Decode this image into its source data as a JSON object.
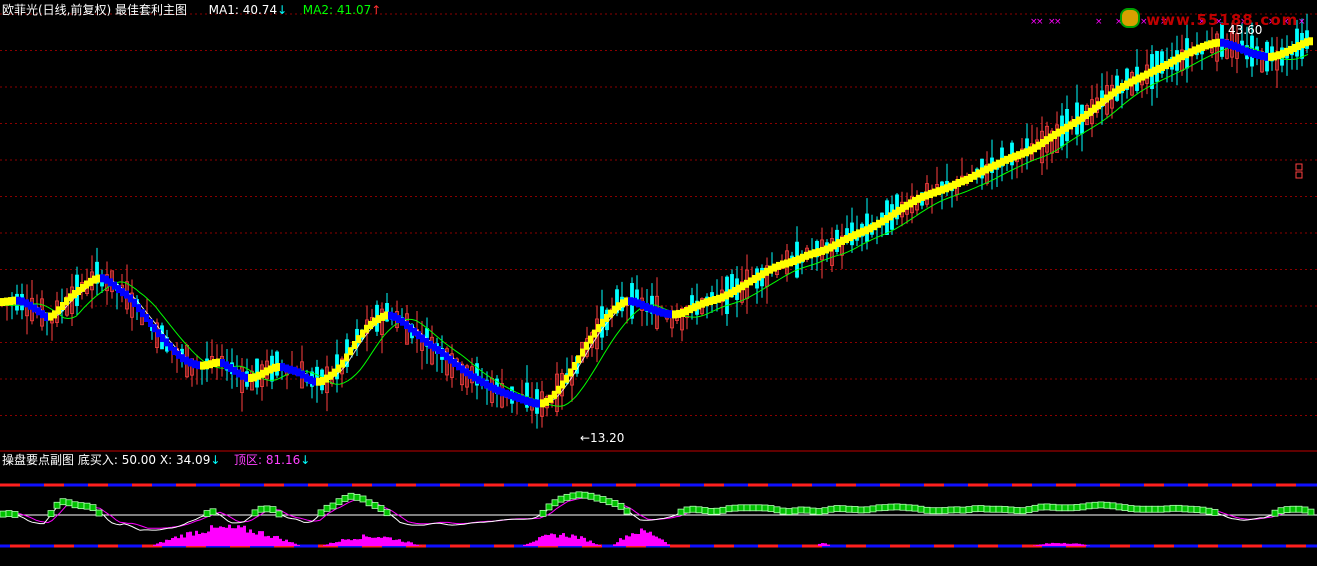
{
  "header": {
    "main_title": "欧菲光(日线,前复权) 最佳套利主图",
    "ma1_label": "MA1: ",
    "ma1_value": "40.74",
    "ma1_arrow": "↓",
    "ma2_label": "MA2: ",
    "ma2_value": "41.07",
    "ma2_arrow": "↑",
    "sub_title": "操盘要点副图",
    "sub_buy_label": "底买入: ",
    "sub_buy_value": "50.00",
    "sub_x_label": "X: ",
    "sub_x_value": "34.09",
    "sub_x_arrow": "↓",
    "sub_top_label": "顶区: ",
    "sub_top_value": "81.16",
    "sub_top_arrow": "↓"
  },
  "watermark": {
    "text": "www.55188.com"
  },
  "annotations": {
    "high_label": "43.60",
    "low_label": "←13.20"
  },
  "colors": {
    "background": "#000000",
    "ma1": "#ffffff",
    "ma2": "#00ff00",
    "up_candle": "#ff4040",
    "down_candle": "#00ffff",
    "trend_up": "#ffff00",
    "trend_down": "#0000ff",
    "grid": "#8b0000",
    "magenta": "#ff00ff",
    "oscillator": "#ffffff"
  },
  "chart_data": {
    "type": "line",
    "series": [
      {
        "x": [
          0,
          10,
          20,
          30,
          40,
          50,
          60,
          70,
          80,
          90,
          100,
          110,
          120,
          130,
          140,
          150,
          160,
          170,
          180,
          190,
          200,
          210,
          220,
          230,
          240,
          250,
          260,
          270,
          280,
          290,
          300,
          310,
          320,
          330,
          340,
          350,
          360,
          370,
          380,
          390,
          400,
          410,
          420,
          430,
          440,
          450,
          460,
          470,
          480,
          490,
          500,
          510,
          520,
          530,
          540,
          550,
          560,
          570,
          580,
          590,
          600,
          610,
          620,
          630,
          640,
          650,
          660,
          670,
          680,
          690,
          700,
          710,
          720,
          730,
          740,
          750,
          760,
          770,
          780,
          790,
          800,
          810,
          820,
          830,
          840,
          850,
          860,
          870,
          880,
          890,
          900,
          910,
          920,
          930,
          940,
          950,
          960,
          970,
          980,
          990,
          1000,
          1010,
          1020,
          1030,
          1040,
          1050,
          1060,
          1070,
          1080,
          1090,
          1100,
          1110,
          1120,
          1130,
          1140,
          1150,
          1160,
          1170,
          1180,
          1190,
          1200,
          1210,
          1220,
          1230,
          1240,
          1250,
          1260,
          1270,
          1280,
          1290,
          1300,
          1310
        ],
        "y": [
          21.8,
          21.9,
          22.0,
          21.6,
          21.0,
          20.4,
          21.2,
          22.2,
          22.8,
          23.5,
          23.9,
          23.6,
          22.8,
          22.3,
          21.2,
          20.2,
          19.1,
          18.2,
          17.3,
          16.8,
          16.5,
          16.6,
          16.9,
          16.4,
          15.8,
          15.4,
          15.7,
          16.2,
          16.5,
          16.2,
          16.0,
          15.3,
          15.1,
          15.6,
          16.3,
          17.6,
          18.9,
          19.9,
          20.5,
          20.8,
          20.4,
          19.7,
          19.0,
          18.3,
          17.8,
          17.1,
          16.4,
          15.8,
          15.3,
          14.8,
          14.4,
          14.1,
          13.8,
          13.5,
          13.3,
          13.6,
          14.6,
          15.8,
          17.2,
          18.6,
          19.8,
          20.8,
          21.6,
          22.0,
          21.7,
          21.3,
          21.0,
          20.8,
          20.8,
          21.2,
          21.6,
          21.9,
          22.1,
          22.5,
          23.0,
          23.5,
          24.0,
          24.5,
          24.9,
          25.1,
          25.4,
          25.8,
          26.0,
          26.3,
          26.8,
          27.2,
          27.6,
          27.9,
          28.4,
          28.9,
          29.5,
          30.0,
          30.5,
          30.8,
          31.1,
          31.4,
          31.8,
          32.1,
          32.6,
          33.0,
          33.4,
          33.8,
          34.1,
          34.4,
          34.9,
          35.5,
          36.0,
          36.5,
          37.0,
          37.6,
          38.3,
          39.0,
          39.6,
          40.1,
          40.5,
          40.9,
          41.3,
          41.7,
          42.2,
          42.6,
          43.0,
          43.3,
          43.5,
          43.3,
          43.0,
          42.6,
          42.4,
          42.2,
          42.4,
          42.8,
          43.2,
          43.6
        ]
      }
    ],
    "ylim": [
      12,
      44.5
    ]
  }
}
